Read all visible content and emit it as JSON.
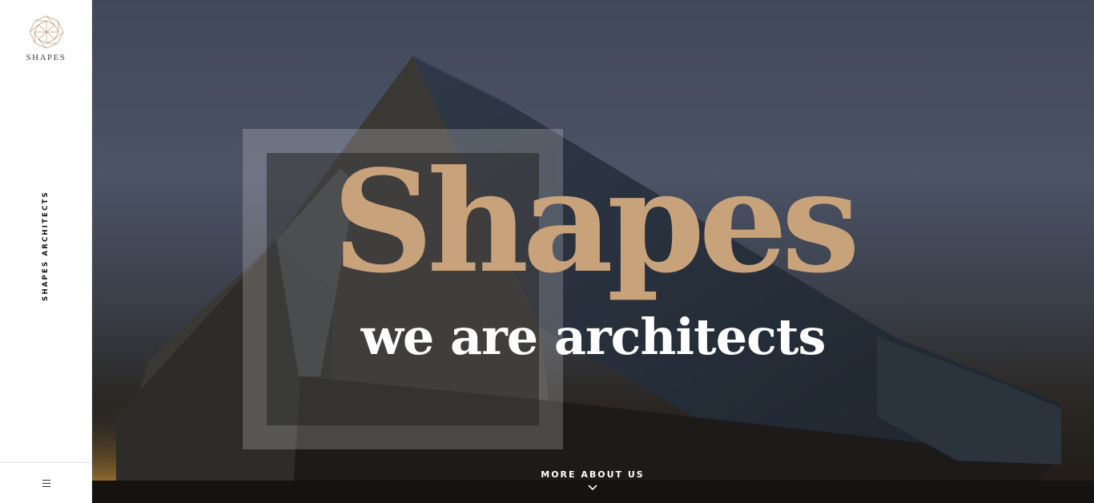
{
  "sidebar": {
    "logo_text": "SHAPES",
    "vertical_label": "SHAPES ARCHITECTS",
    "menu_icon": "hamburger-icon"
  },
  "hero": {
    "headline": "Shapes",
    "subheadline": "we are architects",
    "cta_label": "MORE ABOUT US",
    "cta_icon": "chevron-down-icon"
  },
  "colors": {
    "accent": "#c8a27b",
    "logo": "#c49a74",
    "text_on_dark": "#ffffff"
  }
}
